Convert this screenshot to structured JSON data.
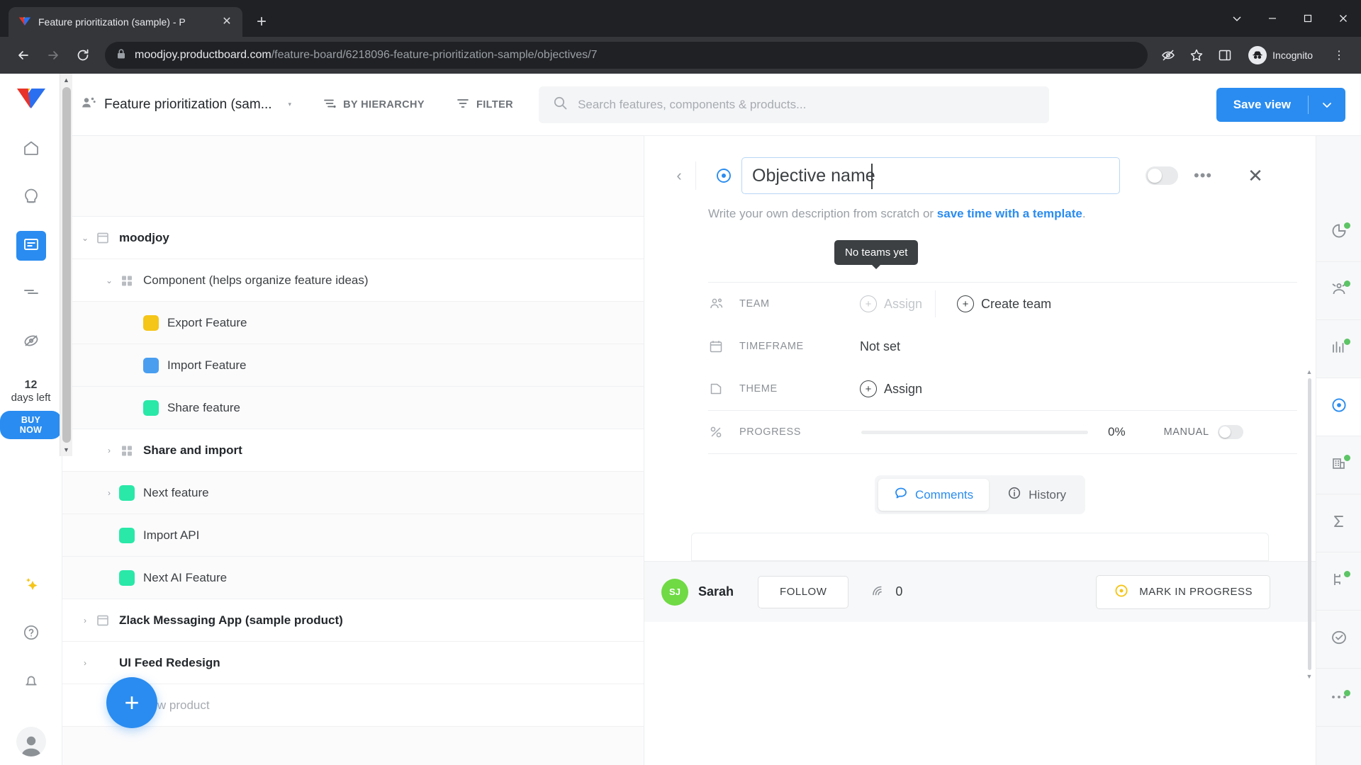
{
  "browser": {
    "tab": {
      "title": "Feature prioritization (sample) - P",
      "favicon_name": "productboard-favicon",
      "close_label": "✕"
    },
    "new_tab_label": "+",
    "window": {
      "minimize": "–",
      "maximize": "□",
      "close": "✕",
      "chevron": "⌄"
    },
    "nav": {
      "back": "←",
      "forward": "→",
      "reload": "↻"
    },
    "omnibox": {
      "lock_icon": "lock-icon",
      "domain": "moodjoy.productboard.com",
      "path": "/feature-board/6218096-feature-prioritization-sample/objectives/7"
    },
    "profile_label": "Incognito",
    "menu_label": "⋮"
  },
  "left_rail": {
    "logo_name": "productboard-logo",
    "icons": [
      {
        "name": "home-icon",
        "active": false
      },
      {
        "name": "insights-idea-icon",
        "active": false
      },
      {
        "name": "features-board-icon",
        "active": true
      },
      {
        "name": "roadmap-lines-icon",
        "active": false
      },
      {
        "name": "portal-icon",
        "active": false
      }
    ],
    "trial": {
      "days": "12",
      "text": "days left",
      "cta": "BUY NOW"
    },
    "bottom_icons": [
      {
        "name": "sparkle-ai-icon"
      },
      {
        "name": "help-question-icon"
      },
      {
        "name": "notifications-bell-icon"
      }
    ],
    "avatar_name": "user-avatar"
  },
  "topbar": {
    "board_name": "Feature prioritization (sam...",
    "board_icon": "people-board-icon",
    "dropdown_caret": "▾",
    "hierarchy_label": "BY HIERARCHY",
    "filter_label": "FILTER",
    "search_placeholder": "Search features, components & products...",
    "save_view_label": "Save view",
    "save_view_caret": "⌄"
  },
  "tree": {
    "rows": [
      {
        "label": "moodjoy",
        "icon": "product-icon",
        "twisty": "⌄",
        "indent": 0,
        "bold": true,
        "white": true
      },
      {
        "label": "Component (helps organize feature ideas)",
        "icon": "component-grid-icon",
        "twisty": "⌄",
        "indent": 1,
        "bold": false,
        "white": true
      },
      {
        "label": "Export Feature",
        "icon": "swatch",
        "color": "#f5c518",
        "twisty": "",
        "indent": 2,
        "bold": false,
        "white": false
      },
      {
        "label": "Import Feature",
        "icon": "swatch",
        "color": "#4a9ef0",
        "twisty": "",
        "indent": 2,
        "bold": false,
        "white": false
      },
      {
        "label": "Share feature",
        "icon": "swatch",
        "color": "#2ae8a8",
        "twisty": "",
        "indent": 2,
        "bold": false,
        "white": false
      },
      {
        "label": "Share and import",
        "icon": "component-grid-icon",
        "twisty": "›",
        "indent": 1,
        "bold": true,
        "white": true
      },
      {
        "label": "Next feature",
        "icon": "swatch",
        "color": "#2ae8a8",
        "twisty": "›",
        "indent": 1,
        "bold": false,
        "white": false
      },
      {
        "label": "Import API",
        "icon": "swatch",
        "color": "#2ae8a8",
        "twisty": "",
        "indent": 1,
        "bold": false,
        "white": false
      },
      {
        "label": "Next AI Feature",
        "icon": "swatch",
        "color": "#2ae8a8",
        "twisty": "",
        "indent": 1,
        "bold": false,
        "white": false
      },
      {
        "label": "Zlack Messaging App (sample product)",
        "icon": "product-icon",
        "twisty": "›",
        "indent": 0,
        "bold": true,
        "white": true
      },
      {
        "label": "UI Feed Redesign",
        "icon": "",
        "twisty": "›",
        "indent": 0,
        "bold": true,
        "white": true
      },
      {
        "label": "Add new product",
        "icon": "",
        "twisty": "",
        "indent": 0,
        "bold": false,
        "white": true,
        "muted": true
      }
    ],
    "fab_label": "+"
  },
  "detail": {
    "back_label": "‹",
    "objective_icon": "objective-target-icon",
    "name_value": "Objective name",
    "toggle_name": "objective-visibility-toggle",
    "more_label": "•••",
    "close_label": "✕",
    "description_prefix": "Write your own description from scratch or ",
    "description_link": "save time with a template",
    "description_suffix": ".",
    "tooltip": "No teams yet",
    "rows": {
      "team": {
        "label": "TEAM",
        "icon": "team-icon",
        "assign": "Assign",
        "create": "Create team"
      },
      "timeframe": {
        "label": "TIMEFRAME",
        "icon": "calendar-icon",
        "value": "Not set"
      },
      "theme": {
        "label": "THEME",
        "icon": "folder-icon",
        "assign": "Assign"
      },
      "progress": {
        "label": "PROGRESS",
        "icon": "percent-icon",
        "percent": "0%",
        "manual_label": "MANUAL",
        "fill": 0
      }
    },
    "tabs": [
      {
        "label": "Comments",
        "icon": "comment-bubble-icon",
        "active": true
      },
      {
        "label": "History",
        "icon": "info-circle-icon",
        "active": false
      }
    ]
  },
  "footer": {
    "avatar_initials": "SJ",
    "user_name": "Sarah",
    "follow_label": "FOLLOW",
    "reach_icon": "reach-signal-icon",
    "reach_value": "0",
    "mark_label": "MARK IN PROGRESS",
    "mark_icon": "objective-target-icon"
  },
  "right_rail": {
    "items": [
      {
        "name": "donut-chart-icon",
        "active": false,
        "badge": true
      },
      {
        "name": "users-chart-icon",
        "active": false,
        "badge": true
      },
      {
        "name": "bar-chart-icon",
        "active": false,
        "badge": true
      },
      {
        "name": "objective-target-icon",
        "active": true,
        "badge": false
      },
      {
        "name": "company-building-icon",
        "active": false,
        "badge": true
      },
      {
        "name": "sigma-sum-icon",
        "active": false,
        "badge": false
      },
      {
        "name": "dependencies-icon",
        "active": false,
        "badge": true
      },
      {
        "name": "status-check-icon",
        "active": false,
        "badge": false
      },
      {
        "name": "more-dots-icon",
        "active": false,
        "badge": true
      }
    ]
  }
}
